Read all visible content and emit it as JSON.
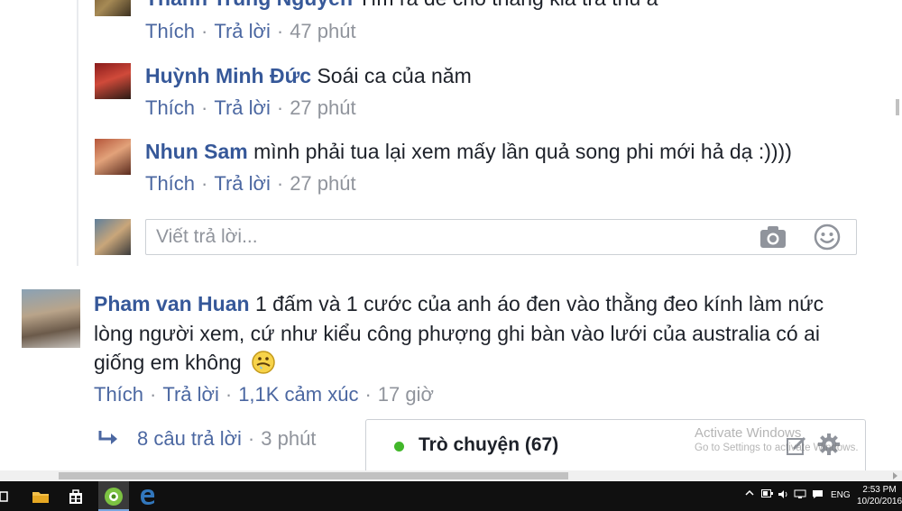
{
  "thread": {
    "top_partial": {
      "name": "Thanh Trung Nguyễn",
      "text": "Tìm ra để cho thằng kia trả thù à",
      "like": "Thích",
      "reply": "Trả lời",
      "time": "47 phút"
    },
    "replies": [
      {
        "name": "Huỳnh Minh Đức",
        "text": "Soái ca của năm",
        "like": "Thích",
        "reply": "Trả lời",
        "time": "27 phút"
      },
      {
        "name": "Nhun Sam",
        "text": "mình phải tua lại xem mấy lần quả song phi mới hả dạ :))))",
        "like": "Thích",
        "reply": "Trả lời",
        "time": "27 phút"
      }
    ],
    "reply_input": {
      "placeholder": "Viết trả lời..."
    }
  },
  "main_comment": {
    "name": "Pham van Huan",
    "text_line1": "1 đấm và 1 cước của anh áo đen vào thằng đeo kính làm nức",
    "text_line2": "lòng người xem, cứ như kiểu công phượng ghi bàn vào lưới của australia có ai",
    "text_line3": "giống em không",
    "like": "Thích",
    "reply": "Trả lời",
    "reactions": "1,1K cảm xúc",
    "time": "17 giờ",
    "replies_link": "8 câu trả lời",
    "replies_time": "3 phút"
  },
  "chat": {
    "label": "Trò chuyện (67)"
  },
  "watermark": {
    "line1": "Activate Windows",
    "line2": "Go to Settings to activate Windows."
  },
  "taskbar": {
    "lang": "ENG",
    "time": "2:53 PM",
    "date": "10/20/2016"
  },
  "colors": {
    "link": "#365899",
    "meta": "#90949c",
    "online": "#42b72a"
  }
}
